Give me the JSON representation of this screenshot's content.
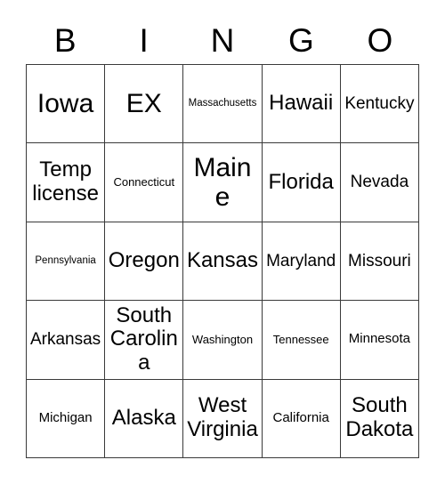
{
  "card": {
    "type": "bingo-card",
    "header_letters": [
      "B",
      "I",
      "N",
      "G",
      "O"
    ],
    "columns": 5,
    "rows": 5,
    "background_color": "#ffffff",
    "text_color": "#000000",
    "grid_line_color": "#3a3a3a",
    "cells": [
      [
        {
          "text": "Iowa",
          "size": "fs-xl"
        },
        {
          "text": "EX",
          "size": "fs-xl"
        },
        {
          "text": "Massachusetts",
          "size": "fs-xxs"
        },
        {
          "text": "Hawaii",
          "size": "fs-lg"
        },
        {
          "text": "Kentucky",
          "size": "fs-md"
        }
      ],
      [
        {
          "text": "Temp license",
          "size": "fs-lg"
        },
        {
          "text": "Connecticut",
          "size": "fs-xs"
        },
        {
          "text": "Maine",
          "size": "fs-xl"
        },
        {
          "text": "Florida",
          "size": "fs-lg"
        },
        {
          "text": "Nevada",
          "size": "fs-md"
        }
      ],
      [
        {
          "text": "Pennsylvania",
          "size": "fs-xxs"
        },
        {
          "text": "Oregon",
          "size": "fs-lg"
        },
        {
          "text": "Kansas",
          "size": "fs-lg"
        },
        {
          "text": "Maryland",
          "size": "fs-md"
        },
        {
          "text": "Missouri",
          "size": "fs-md"
        }
      ],
      [
        {
          "text": "Arkansas",
          "size": "fs-md"
        },
        {
          "text": "South Carolina",
          "size": "fs-lg"
        },
        {
          "text": "Washington",
          "size": "fs-xs"
        },
        {
          "text": "Tennessee",
          "size": "fs-xs"
        },
        {
          "text": "Minnesota",
          "size": "fs-sm"
        }
      ],
      [
        {
          "text": "Michigan",
          "size": "fs-sm"
        },
        {
          "text": "Alaska",
          "size": "fs-lg"
        },
        {
          "text": "West Virginia",
          "size": "fs-lg"
        },
        {
          "text": "California",
          "size": "fs-sm"
        },
        {
          "text": "South Dakota",
          "size": "fs-lg"
        }
      ]
    ]
  }
}
